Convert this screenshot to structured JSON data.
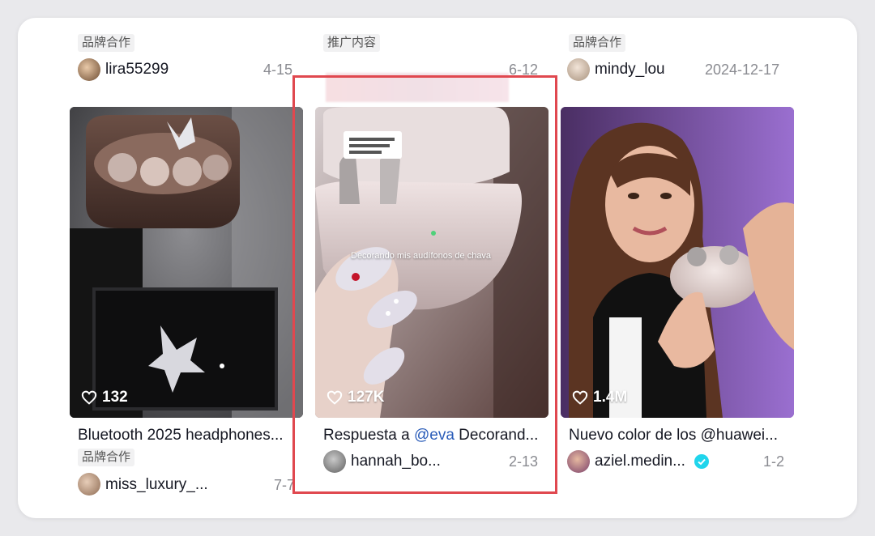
{
  "top_row": {
    "col1": {
      "badge": "品牌合作",
      "author": "lira55299",
      "date": "4-15"
    },
    "col2": {
      "badge": "推广内容",
      "date": "6-12"
    },
    "col3": {
      "badge": "品牌合作",
      "author": "mindy_lou",
      "date": "2024-12-17"
    }
  },
  "videos": [
    {
      "likes": "132",
      "title": "Bluetooth 2025 headphones...",
      "badge": "品牌合作",
      "author": "miss_luxury_...",
      "date": "7-7"
    },
    {
      "likes": "127K",
      "title_prefix": "Respuesta a ",
      "title_mention": "@eva",
      "title_suffix": " Decorand...",
      "author": "hannah_bo...",
      "date": "2-13",
      "overlay_caption": "Decorando mis audífonos de chava"
    },
    {
      "likes": "1.4M",
      "title": "Nuevo color de los @huawei...",
      "author": "aziel.medin...",
      "date": "1-2",
      "verified": true
    }
  ],
  "colors": {
    "highlight_border": "#e0484f",
    "mention": "#2b5db9",
    "verified": "#20d5ec"
  }
}
